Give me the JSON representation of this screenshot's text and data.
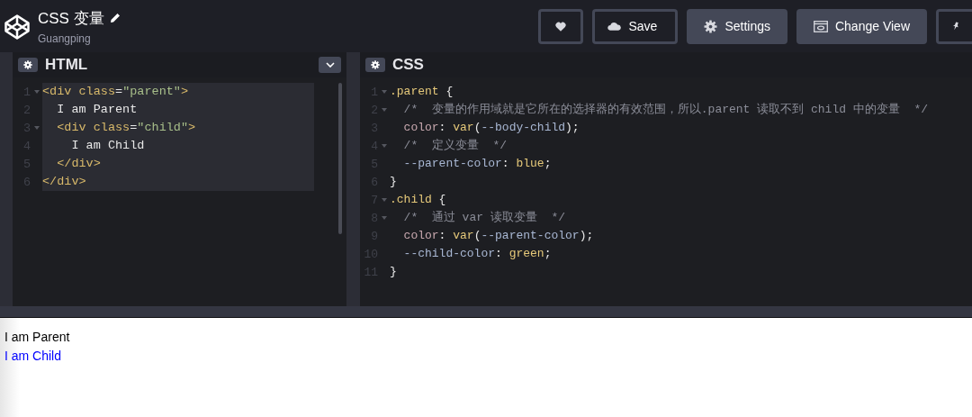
{
  "header": {
    "title": "CSS 变量",
    "author": "Guangping",
    "buttons": [
      {
        "kind": "heart"
      },
      {
        "kind": "cloud",
        "label": "Save"
      },
      {
        "kind": "gear",
        "label": "Settings"
      },
      {
        "kind": "view",
        "label": "Change View"
      },
      {
        "kind": "pin"
      }
    ]
  },
  "html_editor": {
    "title": "HTML",
    "lines": [
      {
        "num": "1",
        "fold": true,
        "selected": true,
        "tokens": [
          {
            "t": "<div ",
            "kind": "tag"
          },
          {
            "t": "class",
            "kind": "attr"
          },
          {
            "t": "=",
            "kind": "punc"
          },
          {
            "t": "\"parent\"",
            "kind": "str"
          },
          {
            "t": ">",
            "kind": "tag"
          }
        ]
      },
      {
        "num": "2",
        "fold": false,
        "selected": true,
        "tokens": [
          {
            "t": "  I am Parent",
            "kind": "text"
          }
        ]
      },
      {
        "num": "3",
        "fold": true,
        "selected": true,
        "tokens": [
          {
            "t": "  <div ",
            "kind": "tag"
          },
          {
            "t": "class",
            "kind": "attr"
          },
          {
            "t": "=",
            "kind": "punc"
          },
          {
            "t": "\"child\"",
            "kind": "str"
          },
          {
            "t": ">",
            "kind": "tag"
          }
        ]
      },
      {
        "num": "4",
        "fold": false,
        "selected": true,
        "tokens": [
          {
            "t": "    I am Child",
            "kind": "text"
          }
        ]
      },
      {
        "num": "5",
        "fold": false,
        "selected": true,
        "tokens": [
          {
            "t": "  </div>",
            "kind": "tag"
          }
        ]
      },
      {
        "num": "6",
        "fold": false,
        "selected": true,
        "tokens": [
          {
            "t": "</div>",
            "kind": "tag"
          }
        ]
      }
    ]
  },
  "css_editor": {
    "title": "CSS",
    "lines": [
      {
        "num": "1",
        "fold": true,
        "tokens": [
          {
            "t": ".parent",
            "kind": "sel"
          },
          {
            "t": " {",
            "kind": "text"
          }
        ]
      },
      {
        "num": "2",
        "fold": true,
        "tokens": [
          {
            "t": "  /*  变量的作用域就是它所在的选择器的有效范围，所以.parent 读取不到 child 中的变量  */",
            "kind": "comment"
          }
        ]
      },
      {
        "num": "3",
        "fold": false,
        "tokens": [
          {
            "t": "  color",
            "kind": "prop"
          },
          {
            "t": ": ",
            "kind": "text"
          },
          {
            "t": "var",
            "kind": "func"
          },
          {
            "t": "(",
            "kind": "text"
          },
          {
            "t": "--body-child",
            "kind": "var"
          },
          {
            "t": ");",
            "kind": "text"
          }
        ]
      },
      {
        "num": "4",
        "fold": true,
        "tokens": [
          {
            "t": "  /*  定义变量  */",
            "kind": "comment"
          }
        ]
      },
      {
        "num": "5",
        "fold": false,
        "tokens": [
          {
            "t": "  --parent-color",
            "kind": "var"
          },
          {
            "t": ": ",
            "kind": "text"
          },
          {
            "t": "blue",
            "kind": "value"
          },
          {
            "t": ";",
            "kind": "text"
          }
        ]
      },
      {
        "num": "6",
        "fold": false,
        "tokens": [
          {
            "t": "}",
            "kind": "text"
          }
        ]
      },
      {
        "num": "7",
        "fold": true,
        "tokens": [
          {
            "t": ".child",
            "kind": "sel"
          },
          {
            "t": " {",
            "kind": "text"
          }
        ]
      },
      {
        "num": "8",
        "fold": true,
        "tokens": [
          {
            "t": "  /*  通过 var 读取变量  */",
            "kind": "comment"
          }
        ]
      },
      {
        "num": "9",
        "fold": false,
        "tokens": [
          {
            "t": "  color",
            "kind": "prop"
          },
          {
            "t": ": ",
            "kind": "text"
          },
          {
            "t": "var",
            "kind": "func"
          },
          {
            "t": "(",
            "kind": "text"
          },
          {
            "t": "--parent-color",
            "kind": "var"
          },
          {
            "t": ");",
            "kind": "text"
          }
        ]
      },
      {
        "num": "10",
        "fold": false,
        "tokens": [
          {
            "t": "  --child-color",
            "kind": "var"
          },
          {
            "t": ": ",
            "kind": "text"
          },
          {
            "t": "green",
            "kind": "value"
          },
          {
            "t": ";",
            "kind": "text"
          }
        ]
      },
      {
        "num": "11",
        "fold": false,
        "tokens": [
          {
            "t": "}",
            "kind": "text"
          }
        ]
      }
    ]
  },
  "preview": {
    "lines": [
      {
        "text": "I am Parent",
        "color": "#000000"
      },
      {
        "text": "I am Child",
        "color": "#0000ff"
      }
    ]
  }
}
